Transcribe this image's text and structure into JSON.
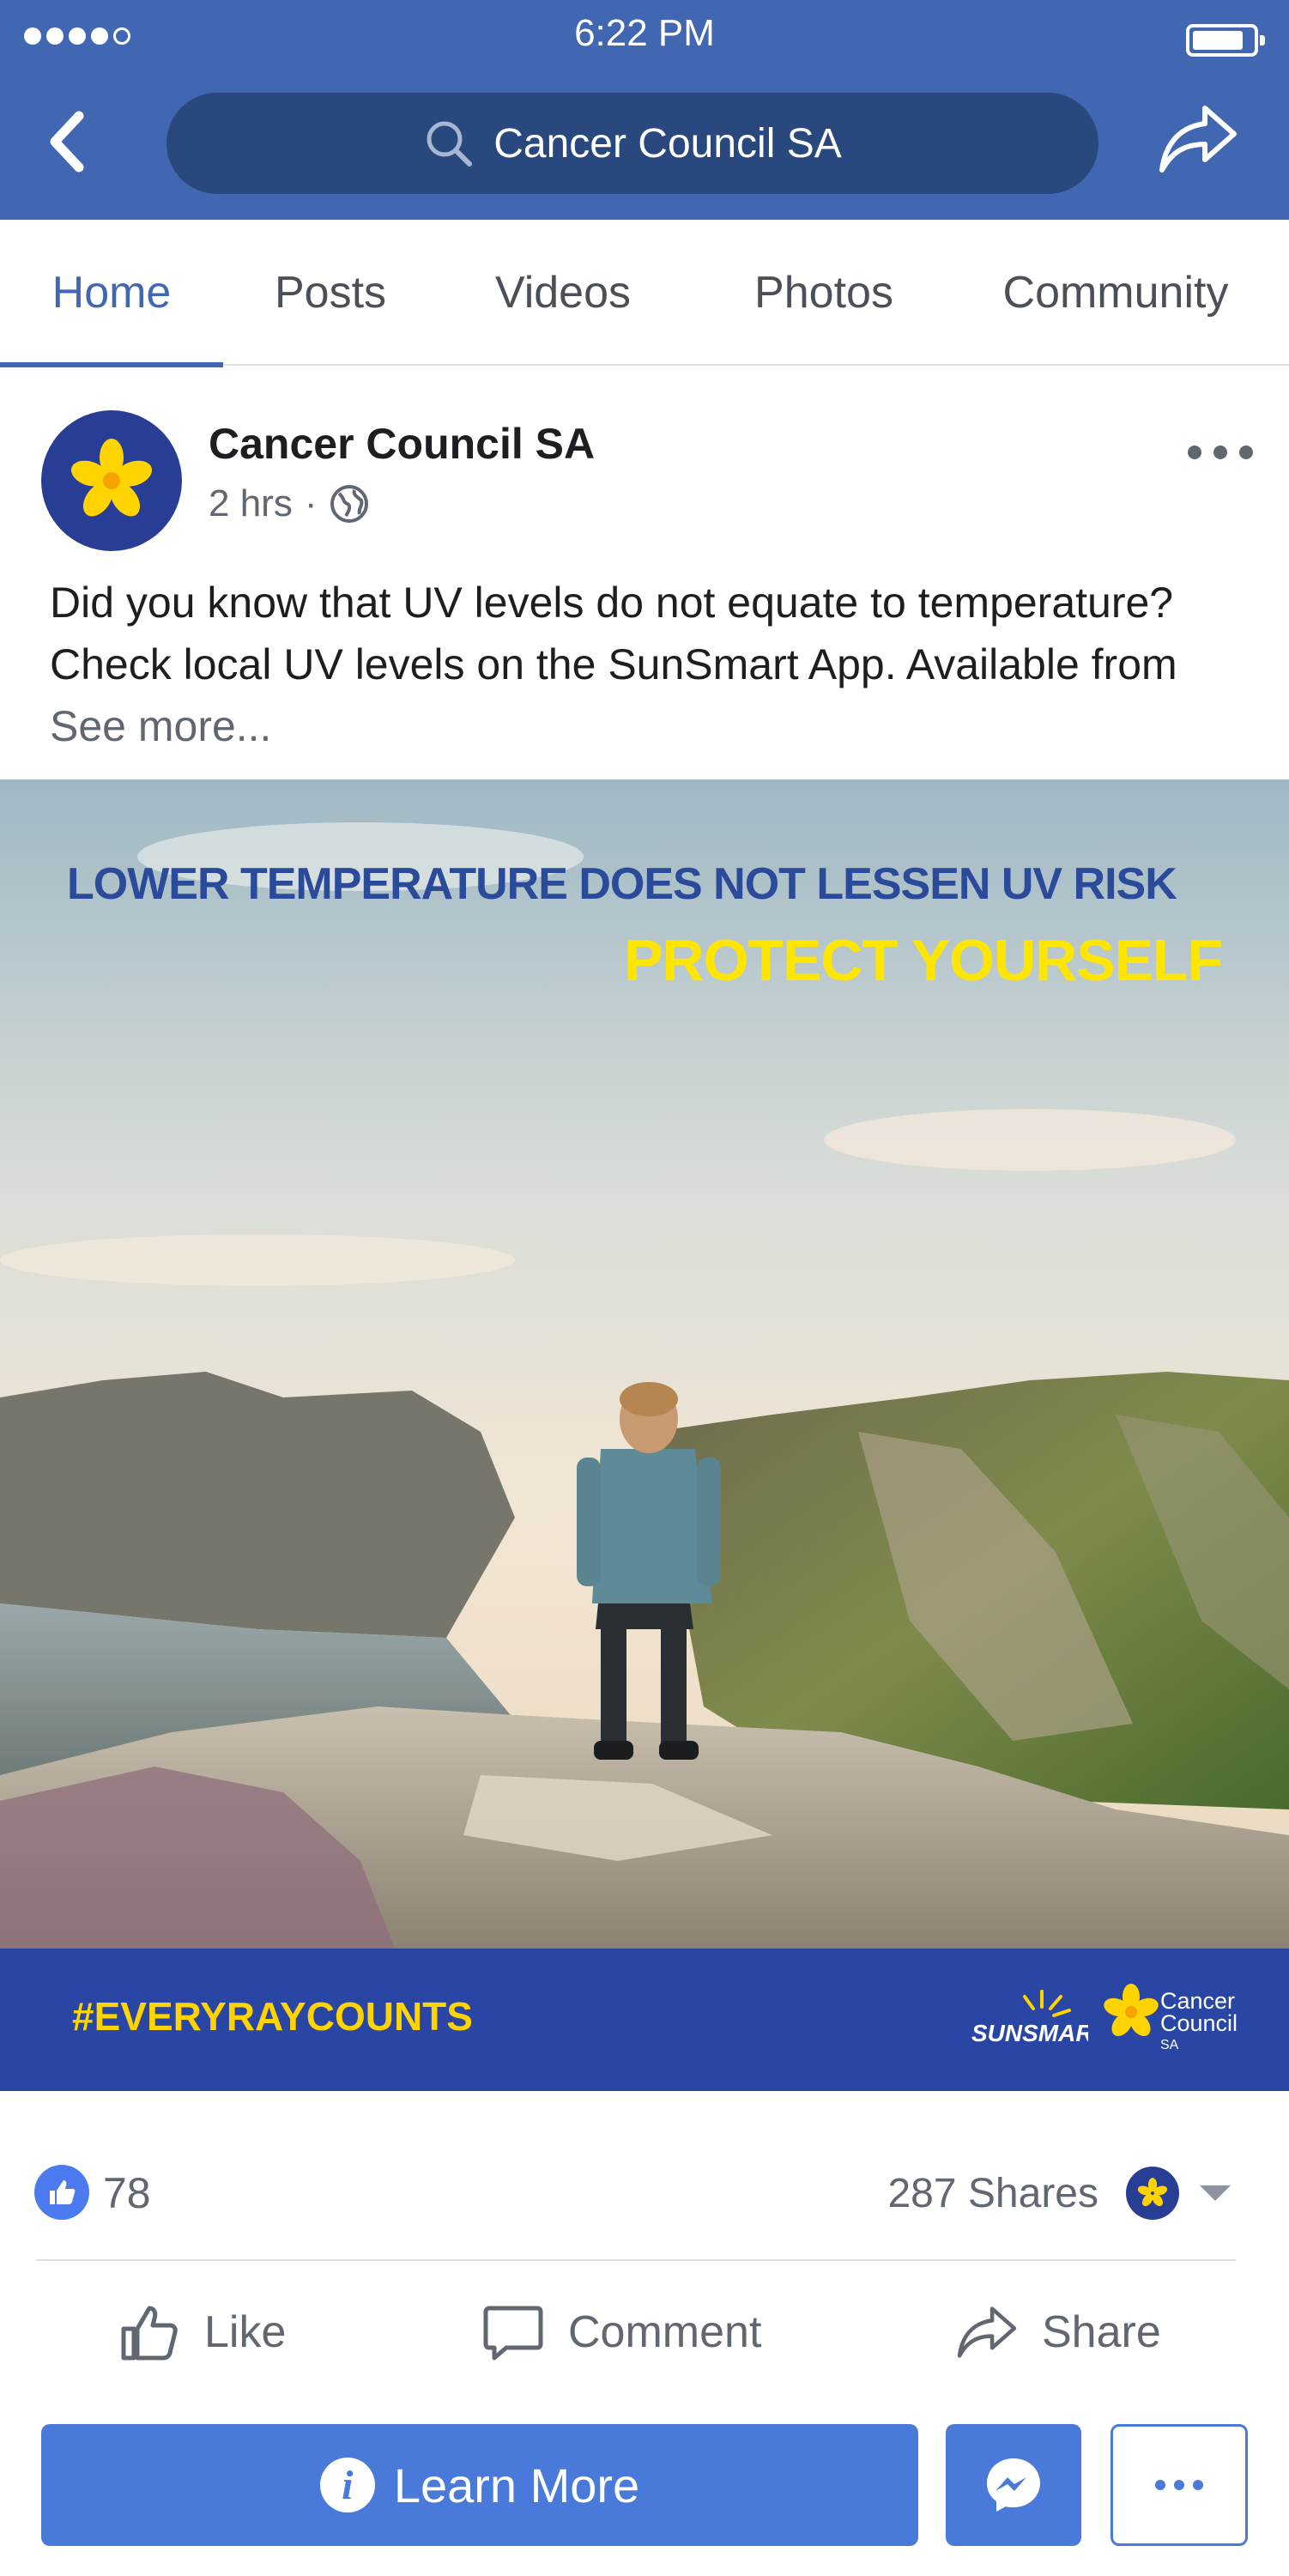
{
  "status_bar": {
    "time": "6:22 PM",
    "signal_bars": 4
  },
  "header": {
    "search_text": "Cancer Council SA"
  },
  "tabs": [
    {
      "label": "Home",
      "active": true
    },
    {
      "label": "Posts",
      "active": false
    },
    {
      "label": "Videos",
      "active": false
    },
    {
      "label": "Photos",
      "active": false
    },
    {
      "label": "Community",
      "active": false
    }
  ],
  "post": {
    "page_name": "Cancer Council SA",
    "time": "2 hrs",
    "separator": "·",
    "text": "Did you know that UV levels do not equate to temperature? Check local UV levels on the SunSmart App. Available from ",
    "see_more": "See more...",
    "image": {
      "headline": "LOWER TEMPERATURE DOES NOT LESSEN UV RISK",
      "subheadline": "PROTECT YOURSELF",
      "hashtag": "#EVERYRAYCOUNTS",
      "logo_sunsmart": "SUNSMART",
      "logo_cc_line1": "Cancer",
      "logo_cc_line2": "Council",
      "logo_cc_line3": "SA"
    },
    "reactions": {
      "likes": "78",
      "shares": "287 Shares"
    },
    "actions": {
      "like": "Like",
      "comment": "Comment",
      "share": "Share"
    }
  },
  "cta": {
    "learn_more": "Learn More"
  },
  "colors": {
    "brand_blue": "#4267b2",
    "header_dark": "#29487d",
    "accent_yellow": "#ffe600",
    "cta_blue": "#4a7ad9"
  }
}
